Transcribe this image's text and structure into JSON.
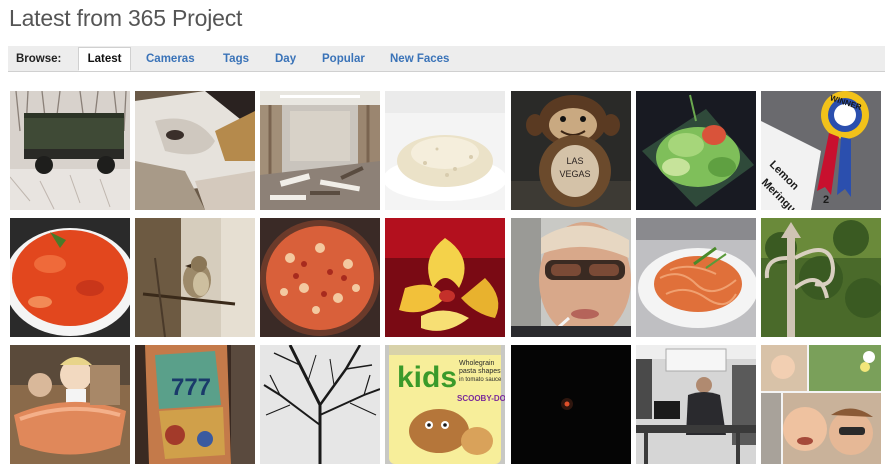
{
  "page": {
    "title": "Latest from 365 Project"
  },
  "nav": {
    "browse_label": "Browse:",
    "tabs": [
      {
        "label": "Latest",
        "active": true
      },
      {
        "label": "Cameras",
        "active": false
      },
      {
        "label": "Tags",
        "active": false
      },
      {
        "label": "Day",
        "active": false
      },
      {
        "label": "Popular",
        "active": false
      },
      {
        "label": "New Faces",
        "active": false
      }
    ]
  },
  "photos": {
    "monkey_text_1": "LAS",
    "monkey_text_2": "VEGAS",
    "ribbon_text": "WINNER",
    "lemon_text_1": "Lemon",
    "lemon_text_2": "Meringue",
    "lemon_text_3": "2",
    "can_text_1": "kids",
    "can_text_2": "Wholegrain",
    "can_text_3": "pasta shapes",
    "can_text_4": "in tomato sauce",
    "can_text_5": "SCOOBY-DOO!",
    "tattoo_text": "777"
  },
  "colors": {
    "link": "#3a73b8",
    "title": "#555555",
    "nav_bg": "#ededed"
  }
}
